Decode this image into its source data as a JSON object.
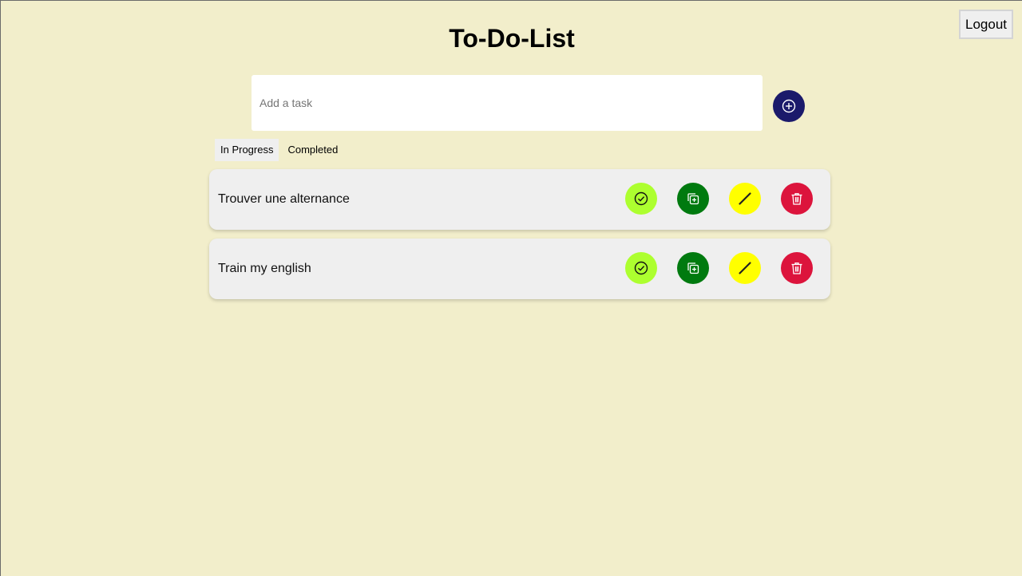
{
  "header": {
    "title": "To-Do-List",
    "logout_label": "Logout"
  },
  "new_task": {
    "placeholder": "Add a task",
    "value": "",
    "add_icon": "plus-circle-icon"
  },
  "tabs": [
    {
      "label": "In Progress",
      "active": true
    },
    {
      "label": "Completed",
      "active": false
    }
  ],
  "tasks": [
    {
      "text": "Trouver une alternance"
    },
    {
      "text": "Train my english"
    }
  ],
  "actions": {
    "complete_icon": "check-circle-icon",
    "duplicate_icon": "copy-plus-icon",
    "edit_icon": "pencil-icon",
    "delete_icon": "trash-icon"
  },
  "colors": {
    "background": "#f2eecb",
    "add_button": "#1b1a6b",
    "complete": "#adff2f",
    "duplicate": "#007a0f",
    "edit": "#ffff00",
    "delete": "#dc143c"
  }
}
